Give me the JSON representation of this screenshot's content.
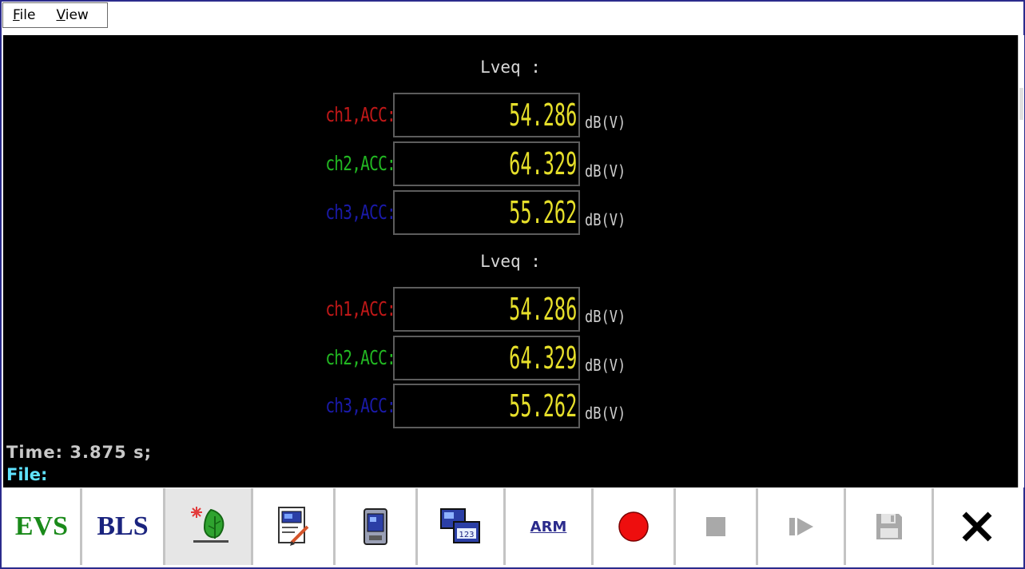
{
  "menu": {
    "items": [
      {
        "mnemonic": "F",
        "rest": "ile"
      },
      {
        "mnemonic": "V",
        "rest": "iew"
      }
    ]
  },
  "display": {
    "sections": [
      {
        "title": "Lveq :",
        "channels": [
          {
            "label": "ch1,ACC:",
            "value": "54.286",
            "unit": "dB(V)",
            "color": "#c01818"
          },
          {
            "label": "ch2,ACC:",
            "value": "64.329",
            "unit": "dB(V)",
            "color": "#22b822"
          },
          {
            "label": "ch3,ACC:",
            "value": "55.262",
            "unit": "dB(V)",
            "color": "#1a1aa8"
          }
        ]
      },
      {
        "title": "Lveq :",
        "channels": [
          {
            "label": "ch1,ACC:",
            "value": "54.286",
            "unit": "dB(V)",
            "color": "#c01818"
          },
          {
            "label": "ch2,ACC:",
            "value": "64.329",
            "unit": "dB(V)",
            "color": "#22b822"
          },
          {
            "label": "ch3,ACC:",
            "value": "55.262",
            "unit": "dB(V)",
            "color": "#1a1aa8"
          }
        ]
      }
    ],
    "value_color": "#e6df2a"
  },
  "status": {
    "time": "Time: 3.875 s;",
    "file": "File:"
  },
  "toolbar": {
    "evs": "EVS",
    "bls": "BLS",
    "arm": "ARM",
    "icons": [
      "evs-button",
      "bls-button",
      "tree-icon",
      "edit-document-icon",
      "device-icon",
      "display-123-icon",
      "arm-button",
      "record-icon",
      "stop-icon",
      "step-play-icon",
      "save-icon",
      "close-icon"
    ]
  }
}
